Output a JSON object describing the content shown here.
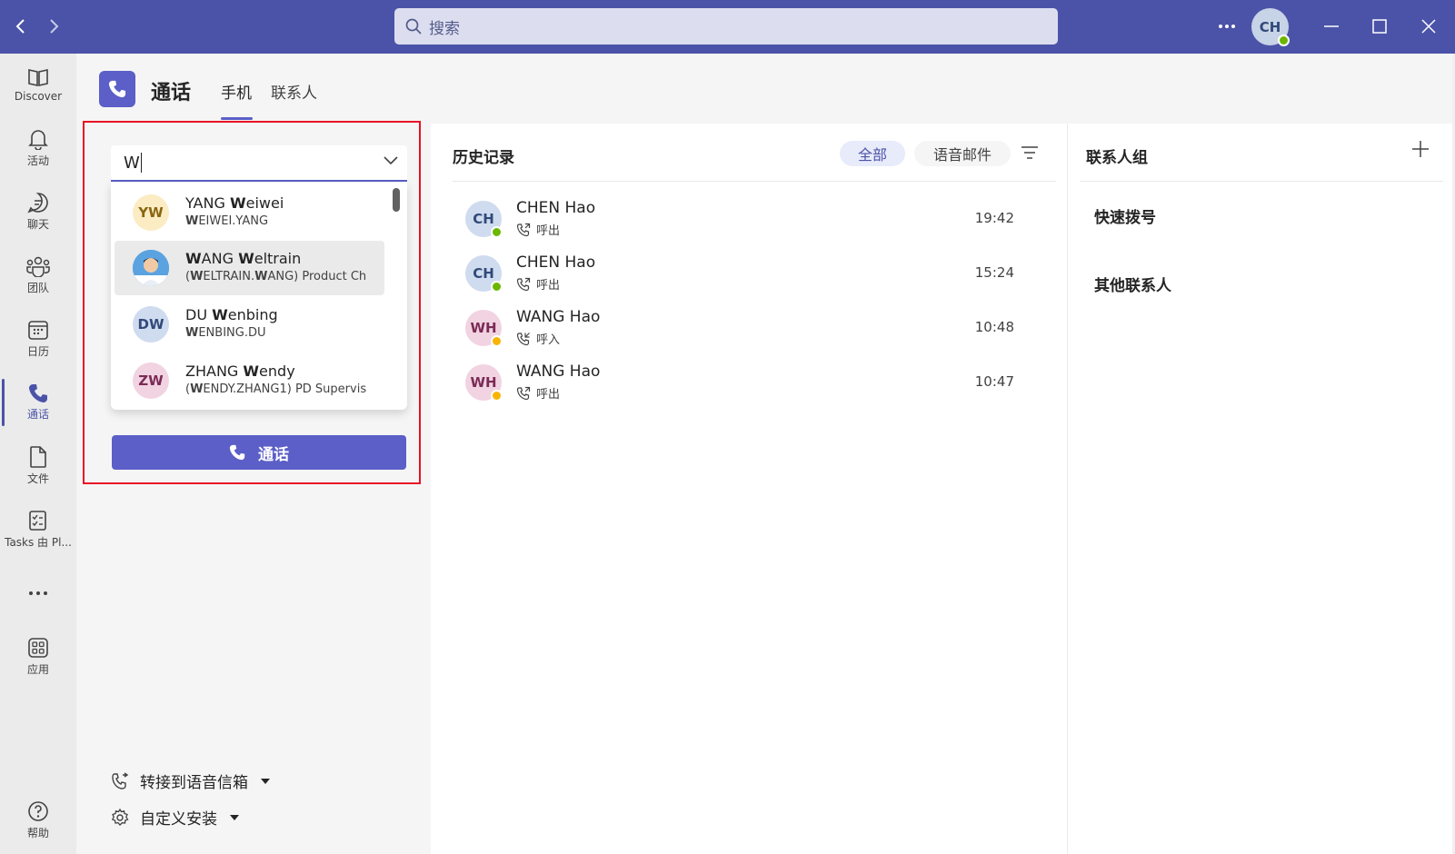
{
  "titlebar": {
    "search_placeholder": "搜索",
    "user_initials": "CH"
  },
  "rail": {
    "items": [
      {
        "label": "Discover"
      },
      {
        "label": "活动"
      },
      {
        "label": "聊天"
      },
      {
        "label": "团队"
      },
      {
        "label": "日历"
      },
      {
        "label": "通话"
      },
      {
        "label": "文件"
      },
      {
        "label": "Tasks 由 Pl..."
      },
      {
        "label": "应用"
      },
      {
        "label": "帮助"
      }
    ]
  },
  "header": {
    "title": "通话",
    "tabs": [
      {
        "label": "手机"
      },
      {
        "label": "联系人"
      }
    ]
  },
  "dial": {
    "input_value": "W",
    "suggestions": [
      {
        "initials": "YW",
        "name_pre": "YANG ",
        "name_bold": "W",
        "name_post": "eiwei",
        "sub_pre": "",
        "sub_b1": "W",
        "sub_mid": "EIWEI.YANG",
        "sub_b2": "",
        "sub_post": ""
      },
      {
        "initials": "",
        "name_pre": "",
        "name_bold": "W",
        "name_mid": "ANG ",
        "name_bold2": "W",
        "name_post": "eltrain",
        "sub_pre": "(",
        "sub_b1": "W",
        "sub_mid": "ELTRAIN.",
        "sub_b2": "W",
        "sub_post": "ANG) Product Ch"
      },
      {
        "initials": "DW",
        "name_pre": "DU ",
        "name_bold": "W",
        "name_post": "enbing",
        "sub_pre": "",
        "sub_b1": "W",
        "sub_mid": "ENBING.DU",
        "sub_b2": "",
        "sub_post": ""
      },
      {
        "initials": "ZW",
        "name_pre": "ZHANG ",
        "name_bold": "W",
        "name_post": "endy",
        "sub_pre": "(",
        "sub_b1": "W",
        "sub_mid": "ENDY.ZHANG1) PD Supervis",
        "sub_b2": "",
        "sub_post": ""
      }
    ],
    "call_label": "通话",
    "forward_label": "转接到语音信箱",
    "custom_label": "自定义安装"
  },
  "history": {
    "title": "历史记录",
    "filter_all": "全部",
    "filter_voicemail": "语音邮件",
    "rows": [
      {
        "initials": "CH",
        "name": "CHEN Hao",
        "direction": "呼出",
        "time": "19:42",
        "presence": "available"
      },
      {
        "initials": "CH",
        "name": "CHEN Hao",
        "direction": "呼出",
        "time": "15:24",
        "presence": "available"
      },
      {
        "initials": "WH",
        "name": "WANG Hao",
        "direction": "呼入",
        "time": "10:48",
        "presence": "away"
      },
      {
        "initials": "WH",
        "name": "WANG Hao",
        "direction": "呼出",
        "time": "10:47",
        "presence": "away"
      }
    ]
  },
  "contacts": {
    "title": "联系人组",
    "groups": [
      {
        "label": "快速拨号"
      },
      {
        "label": "其他联系人"
      }
    ]
  },
  "colors": {
    "brand": "#4b53a8",
    "accent": "#5b5fc7",
    "highlight_border": "#e81123",
    "available": "#6bb700",
    "away": "#f8b400"
  }
}
